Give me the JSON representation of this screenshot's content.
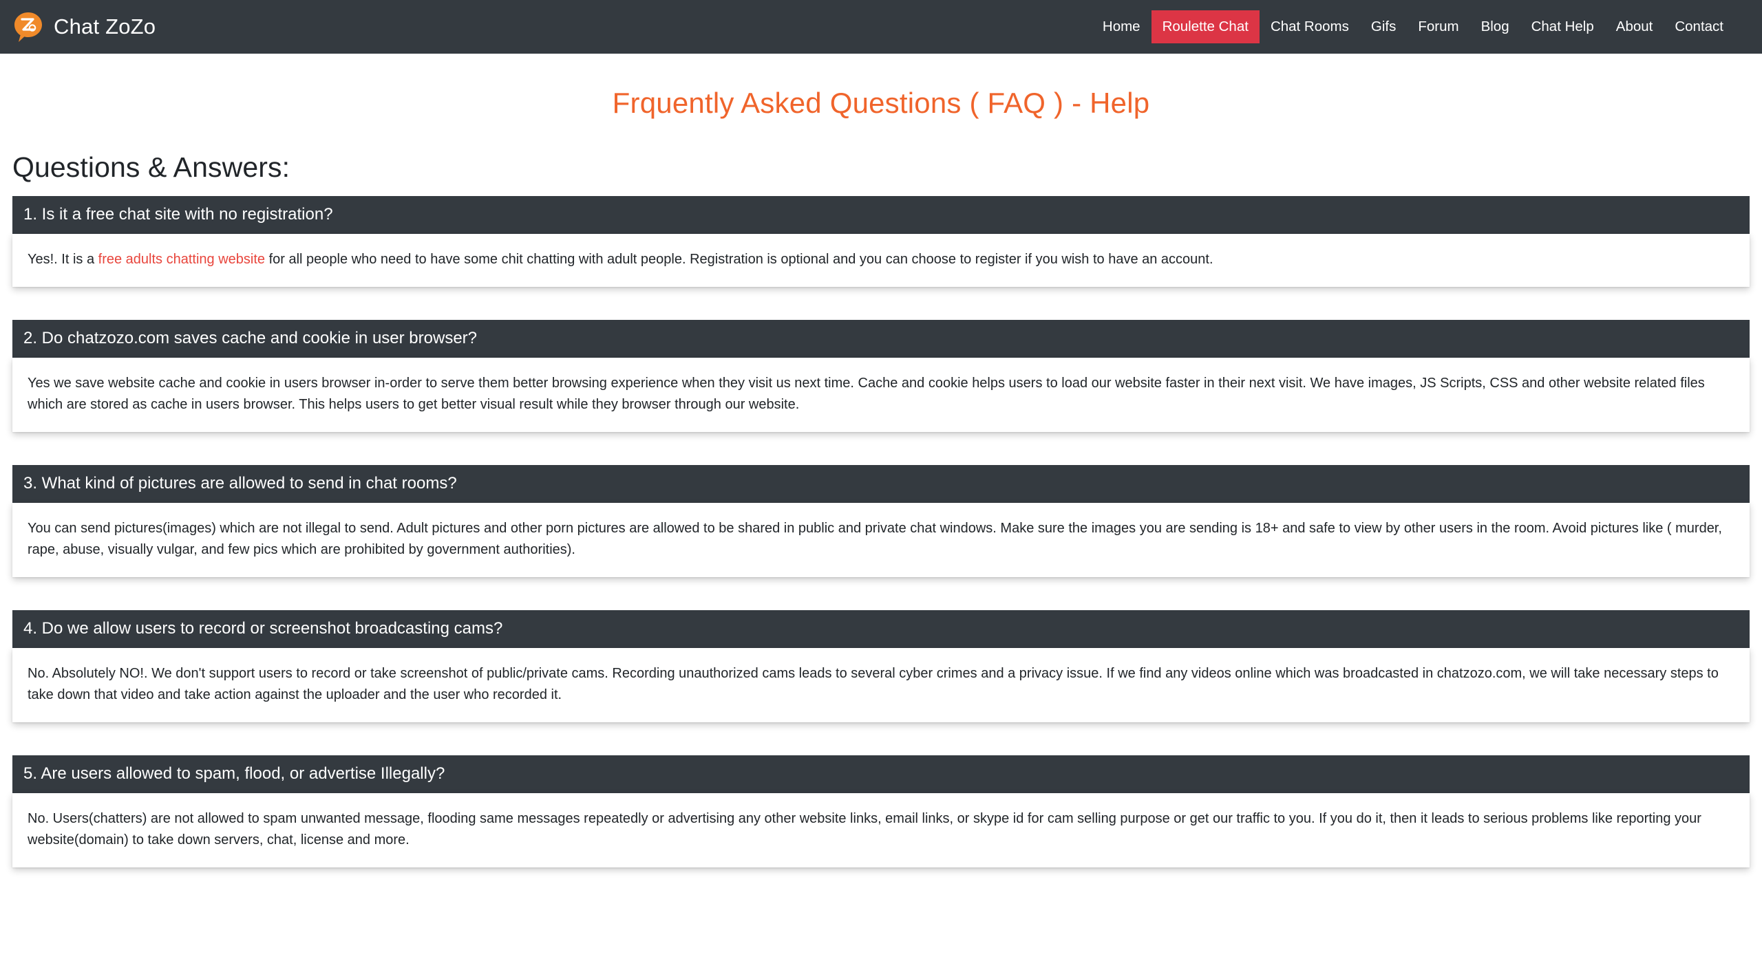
{
  "site": {
    "brand_name": "Chat ZoZo",
    "logo_icon": "chat-bubble-z-logo",
    "brand_color": "#f08a2a",
    "navbar_bg": "#343a40",
    "accent_color": "#dc3545"
  },
  "nav": {
    "items": [
      {
        "label": "Home",
        "active": false
      },
      {
        "label": "Roulette Chat",
        "active": true
      },
      {
        "label": "Chat Rooms",
        "active": false
      },
      {
        "label": "Gifs",
        "active": false
      },
      {
        "label": "Forum",
        "active": false
      },
      {
        "label": "Blog",
        "active": false
      },
      {
        "label": "Chat Help",
        "active": false
      },
      {
        "label": "About",
        "active": false
      },
      {
        "label": "Contact",
        "active": false
      }
    ]
  },
  "page": {
    "title": "Frquently Asked Questions ( FAQ ) - Help",
    "title_color": "#f0642b",
    "section_heading": "Questions & Answers:"
  },
  "faq": {
    "items": [
      {
        "question": "1. Is it a free chat site with no registration?",
        "answer_parts": [
          {
            "type": "text",
            "text": "Yes!. It is a "
          },
          {
            "type": "link",
            "text": "free adults chatting website",
            "color": "#e8453c"
          },
          {
            "type": "text",
            "text": " for all people who need to have some chit chatting with adult people. Registration is optional and you can choose to register if you wish to have an account."
          }
        ]
      },
      {
        "question": "2. Do chatzozo.com saves cache and cookie in user browser?",
        "answer_parts": [
          {
            "type": "text",
            "text": "Yes we save website cache and cookie in users browser in-order to serve them better browsing experience when they visit us next time. Cache and cookie helps users to load our website faster in their next visit. We have images, JS Scripts, CSS and other website related files which are stored as cache in users browser. This helps users to get better visual result while they browser through our website."
          }
        ]
      },
      {
        "question": "3. What kind of pictures are allowed to send in chat rooms?",
        "answer_parts": [
          {
            "type": "text",
            "text": "You can send pictures(images) which are not illegal to send. Adult pictures and other porn pictures are allowed to be shared in public and private chat windows. Make sure the images you are sending is 18+ and safe to view by other users in the room. Avoid pictures like ( murder, rape, abuse, visually vulgar, and few pics which are prohibited by government authorities)."
          }
        ]
      },
      {
        "question": "4. Do we allow users to record or screenshot broadcasting cams?",
        "answer_parts": [
          {
            "type": "text",
            "text": "No. Absolutely NO!. We don't support users to record or take screenshot of public/private cams. Recording unauthorized cams leads to several cyber crimes and a privacy issue. If we find any videos online which was broadcasted in chatzozo.com, we will take necessary steps to take down that video and take action against the uploader and the user who recorded it."
          }
        ]
      },
      {
        "question": "5. Are users allowed to spam, flood, or advertise Illegally?",
        "answer_parts": [
          {
            "type": "text",
            "text": "No. Users(chatters) are not allowed to spam unwanted message, flooding same messages repeatedly or advertising any other website links, email links, or skype id for cam selling purpose or get our traffic to you. If you do it, then it leads to serious problems like reporting your website(domain) to take down servers, chat, license and more."
          }
        ]
      }
    ]
  }
}
